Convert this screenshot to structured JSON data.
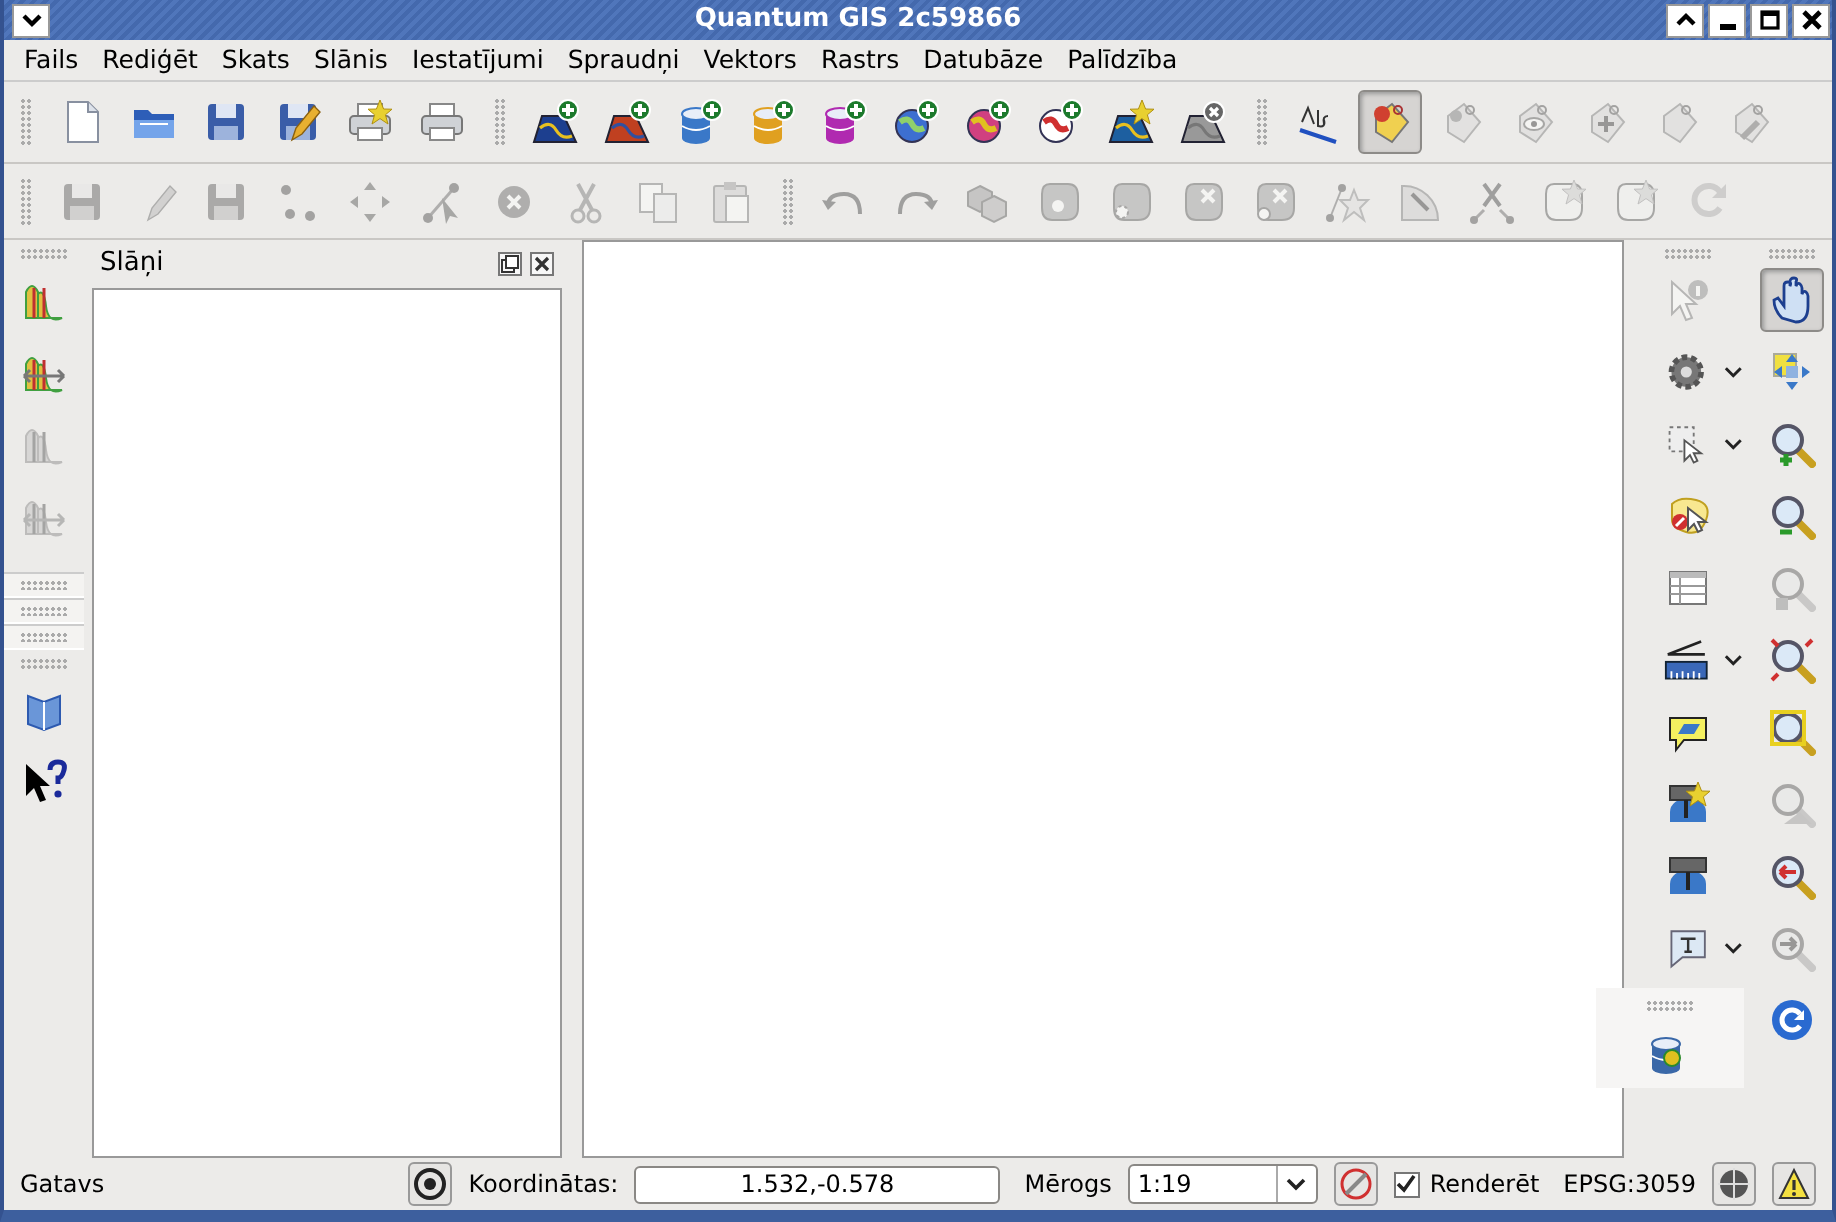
{
  "window": {
    "title": "Quantum GIS 2c59866"
  },
  "menu": [
    "Fails",
    "Rediģēt",
    "Skats",
    "Slānis",
    "Iestatījumi",
    "Spraudņi",
    "Vektors",
    "Rastrs",
    "Datubāze",
    "Palīdzība"
  ],
  "toolbars": {
    "file": [
      {
        "disabled": false,
        "pressed": false
      },
      {
        "disabled": false,
        "pressed": false
      },
      {
        "disabled": false,
        "pressed": false
      },
      {
        "disabled": false,
        "pressed": false
      },
      {
        "disabled": false,
        "pressed": false
      },
      {
        "disabled": false,
        "pressed": false
      }
    ],
    "layers": [
      {
        "disabled": false,
        "pressed": false
      },
      {
        "disabled": false,
        "pressed": false
      },
      {
        "disabled": false,
        "pressed": false
      },
      {
        "disabled": false,
        "pressed": false
      },
      {
        "disabled": false,
        "pressed": false
      },
      {
        "disabled": false,
        "pressed": false
      },
      {
        "disabled": false,
        "pressed": false
      },
      {
        "disabled": false,
        "pressed": false
      },
      {
        "disabled": false,
        "pressed": false
      },
      {
        "disabled": false,
        "pressed": false
      }
    ],
    "labels": [
      {
        "disabled": false,
        "pressed": false
      },
      {
        "disabled": false,
        "pressed": true
      },
      {
        "disabled": true,
        "pressed": false
      },
      {
        "disabled": true,
        "pressed": false
      },
      {
        "disabled": true,
        "pressed": false
      },
      {
        "disabled": true,
        "pressed": false
      },
      {
        "disabled": true,
        "pressed": false
      }
    ],
    "edit": [
      {
        "disabled": true,
        "pressed": false
      },
      {
        "disabled": true,
        "pressed": false
      },
      {
        "disabled": true,
        "pressed": false
      },
      {
        "disabled": true,
        "pressed": false
      },
      {
        "disabled": true,
        "pressed": false
      },
      {
        "disabled": true,
        "pressed": false
      },
      {
        "disabled": true,
        "pressed": false
      },
      {
        "disabled": true,
        "pressed": false
      },
      {
        "disabled": true,
        "pressed": false
      },
      {
        "disabled": true,
        "pressed": false
      }
    ],
    "digitize": [
      {
        "disabled": true,
        "pressed": false
      },
      {
        "disabled": true,
        "pressed": false
      },
      {
        "disabled": true,
        "pressed": false
      },
      {
        "disabled": true,
        "pressed": false
      },
      {
        "disabled": true,
        "pressed": false
      },
      {
        "disabled": true,
        "pressed": false
      },
      {
        "disabled": true,
        "pressed": false
      },
      {
        "disabled": true,
        "pressed": false
      },
      {
        "disabled": true,
        "pressed": false
      },
      {
        "disabled": true,
        "pressed": false
      },
      {
        "disabled": true,
        "pressed": false
      },
      {
        "disabled": true,
        "pressed": false
      },
      {
        "disabled": true,
        "pressed": false
      }
    ],
    "raster": [
      {
        "disabled": false,
        "pressed": false
      },
      {
        "disabled": false,
        "pressed": false
      },
      {
        "disabled": true,
        "pressed": false
      },
      {
        "disabled": true,
        "pressed": false
      }
    ],
    "help": [
      {
        "disabled": false,
        "pressed": false
      },
      {
        "disabled": false,
        "pressed": false
      }
    ],
    "attributes": [
      {
        "disabled": true,
        "pressed": false,
        "dropdown": false
      },
      {
        "disabled": false,
        "pressed": false,
        "dropdown": true
      },
      {
        "disabled": false,
        "pressed": false,
        "dropdown": true
      },
      {
        "disabled": false,
        "pressed": false,
        "dropdown": false
      },
      {
        "disabled": false,
        "pressed": false,
        "dropdown": false
      },
      {
        "disabled": false,
        "pressed": false,
        "dropdown": true
      },
      {
        "disabled": false,
        "pressed": false,
        "dropdown": false
      },
      {
        "disabled": false,
        "pressed": false,
        "dropdown": false
      },
      {
        "disabled": false,
        "pressed": false,
        "dropdown": false
      },
      {
        "disabled": false,
        "pressed": false,
        "dropdown": true
      }
    ],
    "navigation": [
      {
        "disabled": false,
        "pressed": true
      },
      {
        "disabled": false,
        "pressed": false
      },
      {
        "disabled": false,
        "pressed": false
      },
      {
        "disabled": false,
        "pressed": false
      },
      {
        "disabled": true,
        "pressed": false
      },
      {
        "disabled": false,
        "pressed": false
      },
      {
        "disabled": false,
        "pressed": false
      },
      {
        "disabled": true,
        "pressed": false
      },
      {
        "disabled": false,
        "pressed": false
      },
      {
        "disabled": true,
        "pressed": false
      },
      {
        "disabled": false,
        "pressed": false
      }
    ],
    "database": [
      {
        "disabled": false,
        "pressed": false
      }
    ]
  },
  "layers_panel": {
    "title": "Slāņi"
  },
  "status_bar": {
    "message": "Gatavs",
    "coordinates_label": "Koordinātas:",
    "coordinates": "1.532,-0.578",
    "scale_label": "Mērogs",
    "scale": "1:19",
    "render_checked": true,
    "render_label": "Renderēt",
    "crs": "EPSG:3059"
  }
}
